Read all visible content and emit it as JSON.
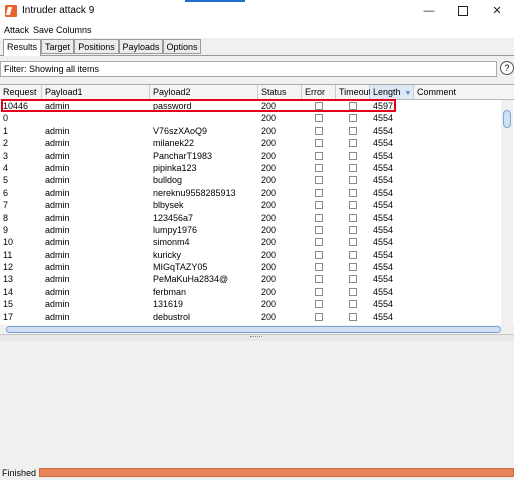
{
  "window": {
    "title": "Intruder attack 9",
    "minimize": "—",
    "close": "✕"
  },
  "menu": [
    "Attack",
    "Save",
    "Columns"
  ],
  "tabs": [
    "Results",
    "Target",
    "Positions",
    "Payloads",
    "Options"
  ],
  "filter": {
    "text": "Filter: Showing all items",
    "help": "?"
  },
  "table": {
    "columns": [
      "Request",
      "Payload1",
      "Payload2",
      "Status",
      "Error",
      "Timeout",
      "Length",
      "Comment"
    ],
    "sort_arrow": "▼",
    "rows": [
      {
        "request": "10446",
        "payload1": "admin",
        "payload2": "password",
        "status": "200",
        "length": "4597"
      },
      {
        "request": "0",
        "payload1": "",
        "payload2": "",
        "status": "200",
        "length": "4554"
      },
      {
        "request": "1",
        "payload1": "admin",
        "payload2": "V76szXAoQ9",
        "status": "200",
        "length": "4554"
      },
      {
        "request": "2",
        "payload1": "admin",
        "payload2": "milanek22",
        "status": "200",
        "length": "4554"
      },
      {
        "request": "3",
        "payload1": "admin",
        "payload2": "PancharT1983",
        "status": "200",
        "length": "4554"
      },
      {
        "request": "4",
        "payload1": "admin",
        "payload2": "pipinka123",
        "status": "200",
        "length": "4554"
      },
      {
        "request": "5",
        "payload1": "admin",
        "payload2": "bulldog",
        "status": "200",
        "length": "4554"
      },
      {
        "request": "6",
        "payload1": "admin",
        "payload2": "nereknu9558285913",
        "status": "200",
        "length": "4554"
      },
      {
        "request": "7",
        "payload1": "admin",
        "payload2": "blbysek",
        "status": "200",
        "length": "4554"
      },
      {
        "request": "8",
        "payload1": "admin",
        "payload2": "123456a7",
        "status": "200",
        "length": "4554"
      },
      {
        "request": "9",
        "payload1": "admin",
        "payload2": "lumpy1976",
        "status": "200",
        "length": "4554"
      },
      {
        "request": "10",
        "payload1": "admin",
        "payload2": "simonm4",
        "status": "200",
        "length": "4554"
      },
      {
        "request": "11",
        "payload1": "admin",
        "payload2": "kuricky",
        "status": "200",
        "length": "4554"
      },
      {
        "request": "12",
        "payload1": "admin",
        "payload2": "MIGqTAZY05",
        "status": "200",
        "length": "4554"
      },
      {
        "request": "13",
        "payload1": "admin",
        "payload2": "PeMaKuHa2834@",
        "status": "200",
        "length": "4554"
      },
      {
        "request": "14",
        "payload1": "admin",
        "payload2": "ferbman",
        "status": "200",
        "length": "4554"
      },
      {
        "request": "15",
        "payload1": "admin",
        "payload2": "131619",
        "status": "200",
        "length": "4554"
      },
      {
        "request": "17",
        "payload1": "admin",
        "payload2": "debustrol",
        "status": "200",
        "length": "4554"
      }
    ]
  },
  "status": {
    "text": "Finished",
    "progress": 1.0
  },
  "colors": {
    "highlight": "#e3001b",
    "progress": "#e9835a",
    "accent": "#1f6fd1"
  }
}
